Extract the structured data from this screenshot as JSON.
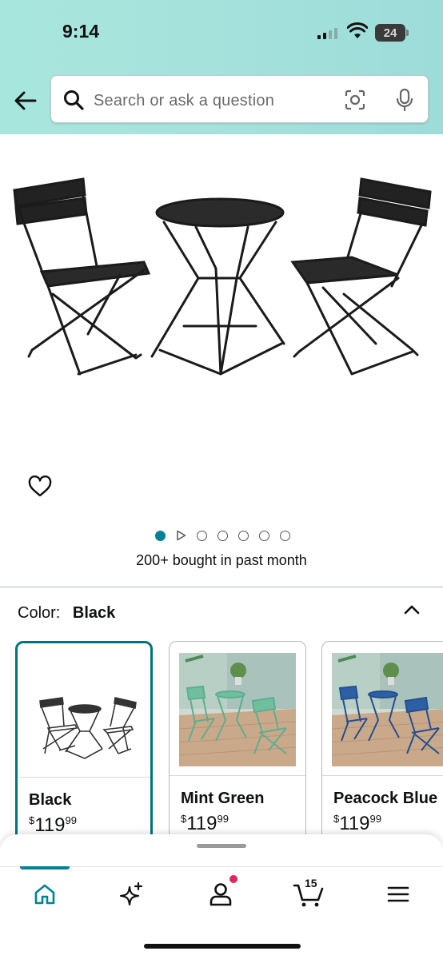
{
  "status_bar": {
    "time": "9:14",
    "battery": "24"
  },
  "search": {
    "placeholder": "Search or ask a question"
  },
  "product": {
    "bought_text": "200+ bought in past month",
    "image_dots_total": 6,
    "image_dot_active": 0
  },
  "color": {
    "label": "Color:",
    "selected": "Black",
    "options": [
      {
        "name": "Black",
        "price_symbol": "$",
        "price_whole": "119",
        "price_cents": "99",
        "selected": true
      },
      {
        "name": "Mint Green",
        "price_symbol": "$",
        "price_whole": "119",
        "price_cents": "99",
        "selected": false
      },
      {
        "name": "Peacock Blue",
        "price_symbol": "$",
        "price_whole": "119",
        "price_cents": "99",
        "selected": false
      }
    ]
  },
  "nav": {
    "cart_count": "15",
    "items": [
      "home-icon",
      "sparkle-icon",
      "account-icon",
      "cart-icon",
      "menu-icon"
    ]
  },
  "colors": {
    "accent": "#008296",
    "selected_border": "#007185",
    "notification": "#e0245e"
  }
}
